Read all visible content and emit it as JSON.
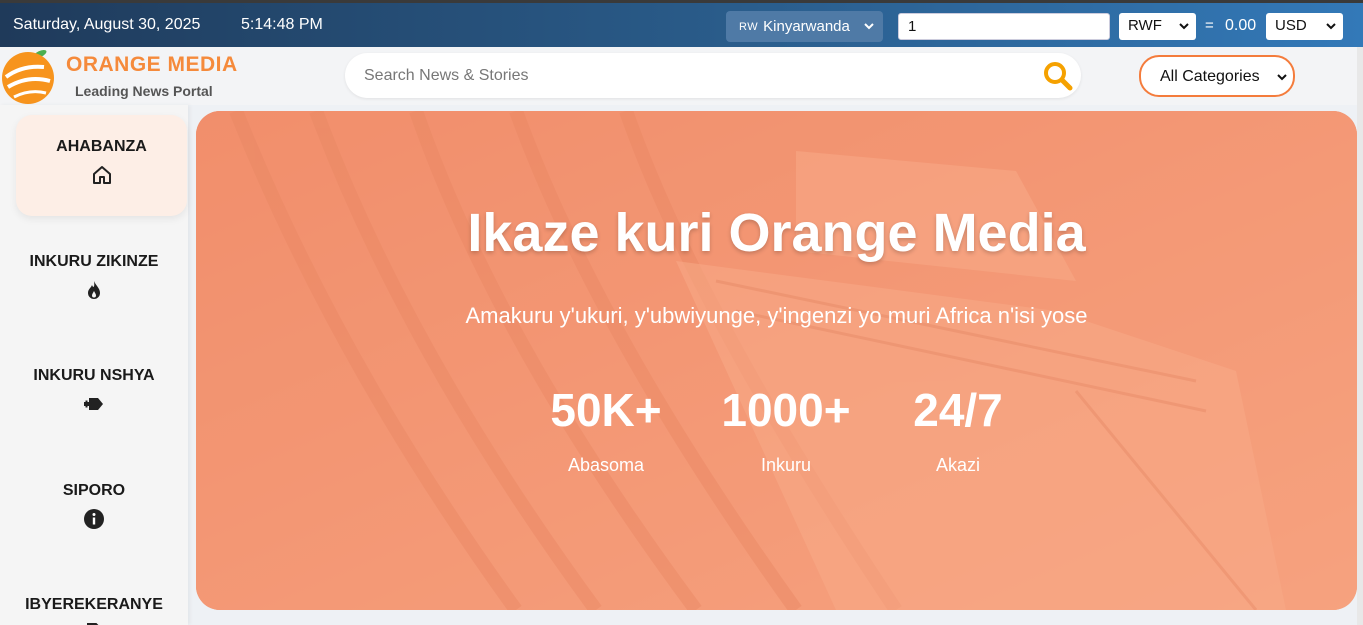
{
  "topbar": {
    "date": "Saturday, August 30, 2025",
    "time": "5:14:48 PM",
    "language": {
      "code": "RW",
      "label": "Kinyarwanda"
    },
    "converter": {
      "amount": "1",
      "from_currency": "RWF",
      "equals": "=",
      "result": "0.00",
      "to_currency": "USD"
    }
  },
  "header": {
    "brand_name": "ORANGE MEDIA",
    "tagline": "Leading News Portal",
    "search_placeholder": "Search News & Stories",
    "category_selected": "All Categories"
  },
  "sidebar": {
    "items": [
      {
        "label": "AHABANZA",
        "icon": "home-icon",
        "active": true
      },
      {
        "label": "INKURU ZIKINZE",
        "icon": "fire-icon",
        "active": false
      },
      {
        "label": "INKURU NSHYA",
        "icon": "new-tag-icon",
        "active": false
      },
      {
        "label": "SIPORO",
        "icon": "info-icon",
        "active": false
      },
      {
        "label": "IBYEREKERANYE",
        "icon": "document-icon",
        "active": false
      }
    ]
  },
  "hero": {
    "title": "Ikaze kuri Orange Media",
    "subtitle": "Amakuru y'ukuri, y'ubwiyunge, y'ingenzi yo muri Africa n'isi yose",
    "stats": [
      {
        "value": "50K+",
        "label": "Abasoma"
      },
      {
        "value": "1000+",
        "label": "Inkuru"
      },
      {
        "value": "24/7",
        "label": "Akazi"
      }
    ]
  },
  "colors": {
    "brand_orange": "#f58a3b",
    "topbar_start": "#1f3a5a",
    "topbar_end": "#3379b8",
    "hero_overlay": "#f8966e"
  }
}
